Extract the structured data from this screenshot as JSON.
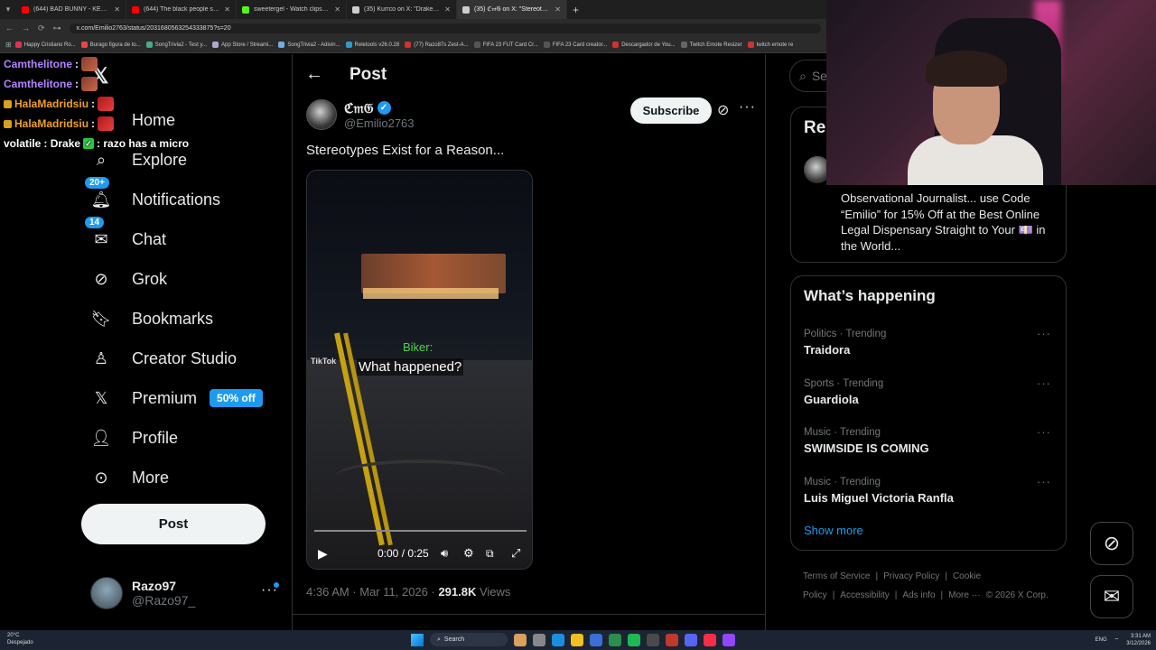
{
  "browser": {
    "tabs": [
      {
        "title": "(644) BAD BUNNY - KETU TeCh...",
        "color": "#ff0000"
      },
      {
        "title": "(644) The black people song ft...",
        "color": "#ff0000"
      },
      {
        "title": "sweetergel - Watch clips on Ki...",
        "color": "#53fc18"
      },
      {
        "title": "(35) Kurrco on X: \"Drake joined...",
        "color": "#cccccc"
      },
      {
        "title": "(35) ℭ𝔪𝔊 on X: \"Stereotypes E...",
        "color": "#cccccc",
        "active": true
      }
    ],
    "url": "x.com/Emilio2763/status/2031680563254333875?s=20",
    "bookmarks": [
      "Happy Cristiano Ro...",
      "Burago figura de to...",
      "SongTrivia2 - Test y...",
      "App Store / Streami...",
      "SongTrivia2 - Adivin...",
      "Reletools v26.0.28",
      "(77) Razo87s Zest-A...",
      "FIFA 23 FUT Card Cr...",
      "FIFA 23 Card creator...",
      "Descargador de You...",
      "Twitch Emote Resizer",
      "twitch emote re"
    ]
  },
  "chat": [
    {
      "user": "Camthelitone",
      "color": "purple",
      "sep": " :",
      "emote": "brown"
    },
    {
      "user": "Camthelitone",
      "color": "purple",
      "sep": " :",
      "emote": "brown"
    },
    {
      "user": "HalaMadridsiu",
      "color": "orange",
      "sep": " :",
      "emote": "red",
      "badge": true
    },
    {
      "user": "HalaMadridsiu",
      "color": "orange",
      "sep": " :",
      "emote": "red",
      "badge": true
    },
    {
      "user": "volatile",
      "color": "white",
      "sep": " : Drake",
      "message": ": razo has a micro"
    }
  ],
  "nav": {
    "items": [
      {
        "label": "Home",
        "icon": "home-icon",
        "glyph": "⌂"
      },
      {
        "label": "Explore",
        "icon": "search-icon",
        "glyph": "⌕"
      },
      {
        "label": "Notifications",
        "icon": "bell-icon",
        "glyph": "🔔︎",
        "badge": "20+"
      },
      {
        "label": "Chat",
        "icon": "mail-icon",
        "glyph": "✉",
        "badge": "14"
      },
      {
        "label": "Grok",
        "icon": "grok-icon",
        "glyph": "⊘"
      },
      {
        "label": "Bookmarks",
        "icon": "bookmark-icon",
        "glyph": "🔖︎"
      },
      {
        "label": "Creator Studio",
        "icon": "creator-studio-icon",
        "glyph": "♙"
      },
      {
        "label": "Premium",
        "icon": "x-premium-icon",
        "glyph": "𝕏",
        "pill": "50% off"
      },
      {
        "label": "Profile",
        "icon": "profile-icon",
        "glyph": "👤︎"
      },
      {
        "label": "More",
        "icon": "more-circle-icon",
        "glyph": "⊙"
      }
    ],
    "post_label": "Post"
  },
  "account": {
    "name": "Razo97",
    "handle": "@Razo97_"
  },
  "main": {
    "title": "Post",
    "author": {
      "name": "ℭ𝔪𝔊",
      "handle": "@Emilio2763"
    },
    "subscribe_label": "Subscribe",
    "text": "Stereotypes Exist for a Reason...",
    "video": {
      "tiktok_label": "TikTok",
      "caption_speaker": "Biker:",
      "caption_text": "What happened?",
      "time": "0:00 / 0:25",
      "progress": 0.0
    },
    "meta": {
      "time": "4:36 AM · Mar 11, 2026 · ",
      "views_count": "291.8K",
      "views_label": " Views"
    }
  },
  "sidebar": {
    "search_placeholder": "Se",
    "relevant_title": "Rel",
    "relevant_bio": "Observational Journalist... use Code “Emilio” for 15% Off at the Best Online Legal Dispensary Straight to Your 💷 in the World...",
    "happening_title": "What’s happening",
    "trends": [
      {
        "category": "Politics · Trending",
        "name": "Traidora"
      },
      {
        "category": "Sports · Trending",
        "name": "Guardiola"
      },
      {
        "category": "Music · Trending",
        "name": "SWIMSIDE IS COMING"
      },
      {
        "category": "Music · Trending",
        "name": "Luis Miguel Victoria Ranfla"
      }
    ],
    "show_more": "Show more",
    "footer": [
      "Terms of Service",
      "|",
      "Privacy Policy",
      "|",
      "Cookie Policy",
      "|",
      "Accessibility",
      "|",
      "Ads info",
      "|",
      "More ···",
      "© 2026 X Corp."
    ]
  },
  "taskbar": {
    "weather_temp": "20°C",
    "weather_desc": "Despejado",
    "search_label": "Search",
    "lang": "ENG",
    "time": "3:31 AM",
    "date": "3/12/2026"
  }
}
